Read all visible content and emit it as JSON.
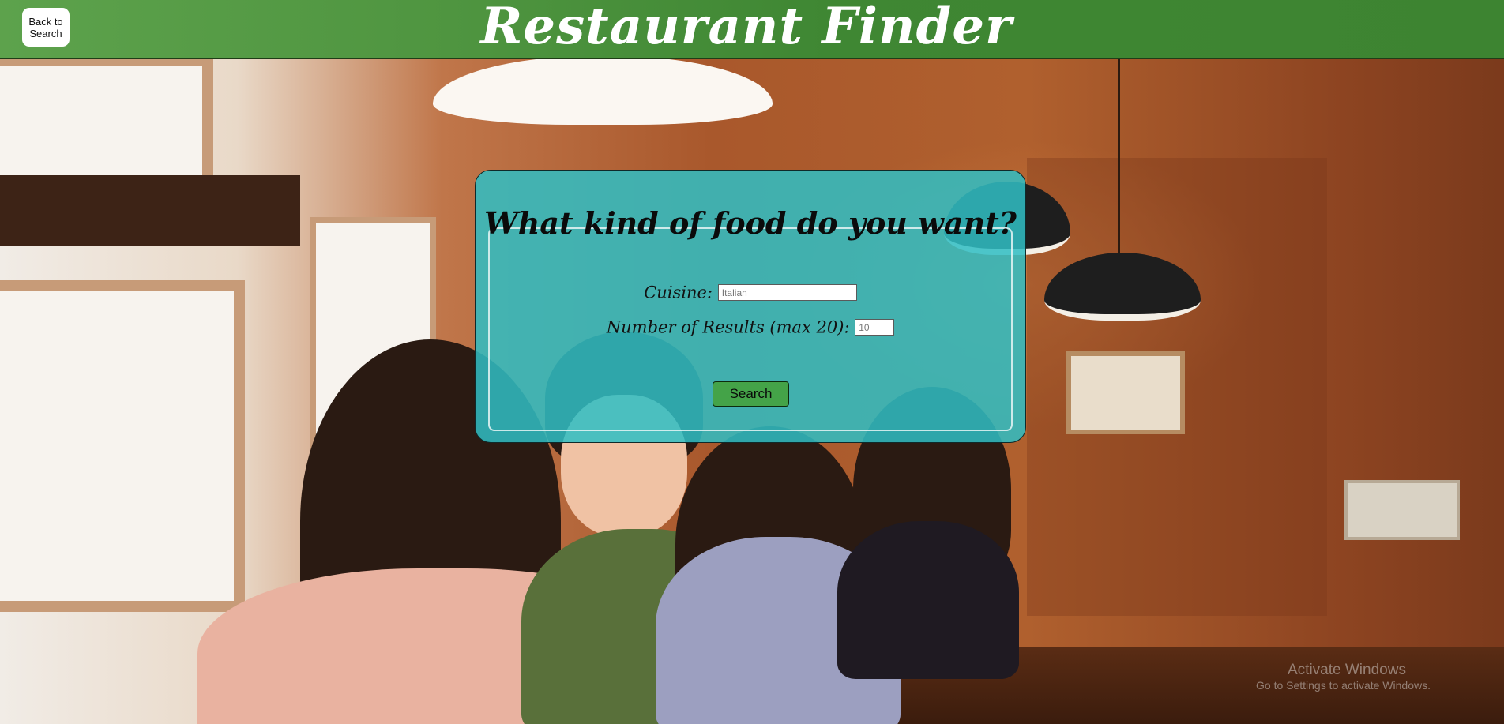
{
  "header": {
    "back_label": "Back to Search",
    "title": "Restaurant Finder",
    "colors": {
      "bar": "#3d8431",
      "title": "#ffffff"
    }
  },
  "search_form": {
    "heading": "What kind of food do you want?",
    "cuisine_label": "Cuisine:",
    "cuisine_value": "Italian",
    "results_label": "Number of Results (max 20):",
    "results_value": "10",
    "search_label": "Search",
    "colors": {
      "panel": "#30bec4",
      "button": "#44a348"
    }
  },
  "watermark": {
    "title": "Activate Windows",
    "subtitle": "Go to Settings to activate Windows."
  }
}
